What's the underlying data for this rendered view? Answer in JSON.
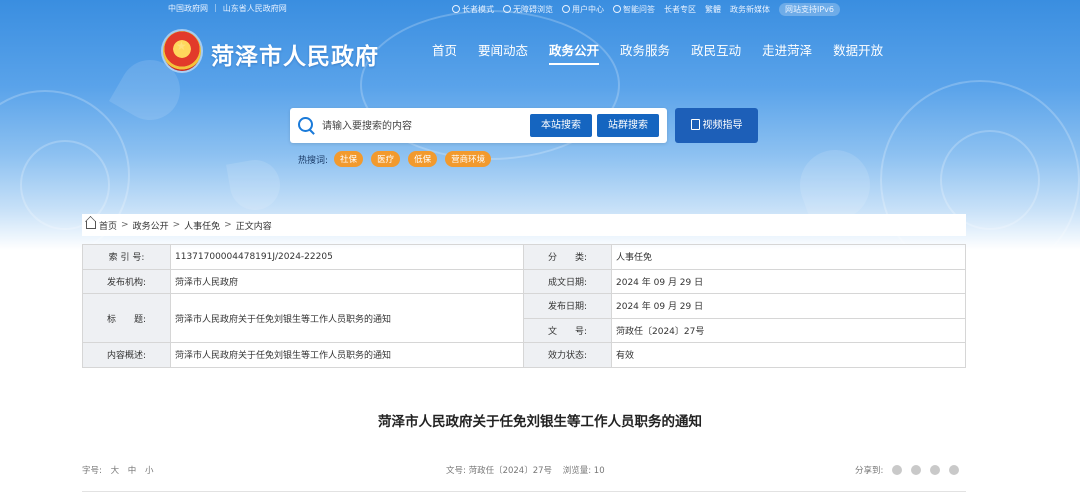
{
  "topbar": {
    "links_left": [
      "中国政府网",
      "山东省人民政府网"
    ],
    "links_right": [
      "长者模式",
      "无障碍浏览",
      "用户中心",
      "智能问答",
      "长者专区",
      "繁體",
      "政务新媒体",
      "网站支持IPv6"
    ]
  },
  "site": {
    "title": "菏泽市人民政府"
  },
  "nav": {
    "items": [
      "首页",
      "要闻动态",
      "政务公开",
      "政务服务",
      "政民互动",
      "走进菏泽",
      "数据开放"
    ],
    "active": "政务公开"
  },
  "search": {
    "placeholder": "请输入要搜索的内容",
    "site_search": "本站搜索",
    "group_search": "站群搜索",
    "video_guide": "视频指导"
  },
  "hot": {
    "label": "热搜词:",
    "tags": [
      "社保",
      "医疗",
      "低保",
      "营商环境"
    ]
  },
  "breadcrumb": [
    "首页",
    "政务公开",
    "人事任免",
    "正文内容"
  ],
  "info": {
    "index_label": "索 引 号:",
    "index_value": "11371700004478191J/2024-22205",
    "category_label": "分　　类:",
    "category_value": "人事任免",
    "publisher_label": "发布机构:",
    "publisher_value": "菏泽市人民政府",
    "created_label": "成文日期:",
    "created_value": "2024 年 09 月 29 日",
    "title_label": "标　　题:",
    "title_value": "菏泽市人民政府关于任免刘银生等工作人员职务的通知",
    "published_label": "发布日期:",
    "published_value": "2024 年 09 月 29 日",
    "docno_label": "文　　号:",
    "docno_value": "菏政任〔2024〕27号",
    "summary_label": "内容概述:",
    "summary_value": "菏泽市人民政府关于任免刘银生等工作人员职务的通知",
    "status_label": "效力状态:",
    "status_value": "有效"
  },
  "article": {
    "title": "菏泽市人民政府关于任免刘银生等工作人员职务的通知",
    "font_label": "字号:",
    "font_sizes": [
      "大",
      "中",
      "小"
    ],
    "docno_meta": "文号: 菏政任〔2024〕27号",
    "views_meta": "浏览量: 10",
    "share_label": "分享到:"
  }
}
